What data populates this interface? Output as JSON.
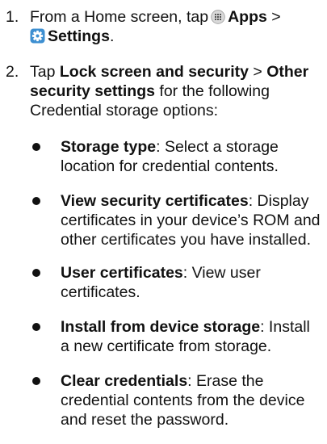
{
  "steps": [
    {
      "number": "1.",
      "intro": "From a Home screen, tap",
      "apps_icon": "apps-grid-icon",
      "apps_label": "Apps",
      "separator": ">",
      "settings_icon": "settings-gear-icon",
      "settings_label": "Settings",
      "period": "."
    },
    {
      "number": "2.",
      "tap": "Tap",
      "lock_label": "Lock screen and security",
      "separator": ">",
      "other_label": "Other security settings",
      "tail": "for the following Credential storage options:"
    }
  ],
  "bullets": [
    {
      "term": "Storage type",
      "desc": ": Select a storage location for credential contents."
    },
    {
      "term": "View security certificates",
      "desc": ": Display certificates in your device’s ROM and other certificates you have installed."
    },
    {
      "term": "User certificates",
      "desc": ": View user certificates."
    },
    {
      "term": "Install from device storage",
      "desc": ": Install a new certificate from storage."
    },
    {
      "term": "Clear credentials",
      "desc": ": Erase the credential contents from the device and reset the password."
    }
  ],
  "colors": {
    "text": "#111111",
    "settings_icon_bg": "#3d8fd1",
    "apps_icon_bg": "#d9d9d9"
  }
}
